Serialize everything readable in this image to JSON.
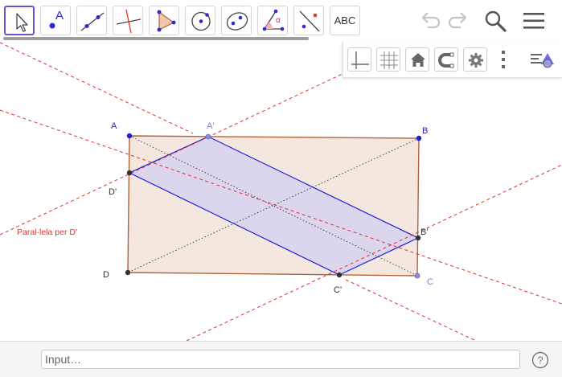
{
  "toolbar": {
    "tools": [
      {
        "name": "move-tool",
        "icon": "cursor-arrow-icon",
        "selected": true
      },
      {
        "name": "point-tool",
        "icon": "point-icon",
        "label": "A"
      },
      {
        "name": "line-tool",
        "icon": "line-icon"
      },
      {
        "name": "perpendicular-tool",
        "icon": "perpendicular-line-icon"
      },
      {
        "name": "polygon-tool",
        "icon": "triangle-icon"
      },
      {
        "name": "circle-tool",
        "icon": "circle-center-point-icon"
      },
      {
        "name": "conic-tool",
        "icon": "ellipse-icon"
      },
      {
        "name": "angle-tool",
        "icon": "angle-icon",
        "label": "α"
      },
      {
        "name": "reflect-tool",
        "icon": "reflect-line-icon"
      },
      {
        "name": "text-tool",
        "icon": "text-icon",
        "label": "ABC"
      }
    ],
    "right_icons": [
      "undo-icon",
      "redo-icon",
      "search-icon",
      "menu-icon"
    ]
  },
  "style_bar": {
    "icons": [
      "axes-icon",
      "grid-icon",
      "home-icon",
      "magnet-icon",
      "gear-icon",
      "more-icon",
      "style-bar-toggle-icon"
    ]
  },
  "graphics": {
    "points": {
      "A": "A",
      "B": "B",
      "C": "C",
      "D": "D",
      "A1": "A'",
      "B1": "B'",
      "C1": "C'",
      "D1": "D'"
    },
    "parallel_label": "Paral·lela per D'",
    "colors": {
      "rectangle_fill": "#f2e6de",
      "rectangle_stroke": "#b0623a",
      "parallelogram_fill": "#d7d2ef",
      "parallelogram_stroke": "#1f1fd6",
      "dashed_lines": "#e03030",
      "label_blue": "#2222cc",
      "label_light_blue": "#7b7be6"
    }
  },
  "input_bar": {
    "placeholder": "Input…",
    "help_icon": "help-icon"
  }
}
